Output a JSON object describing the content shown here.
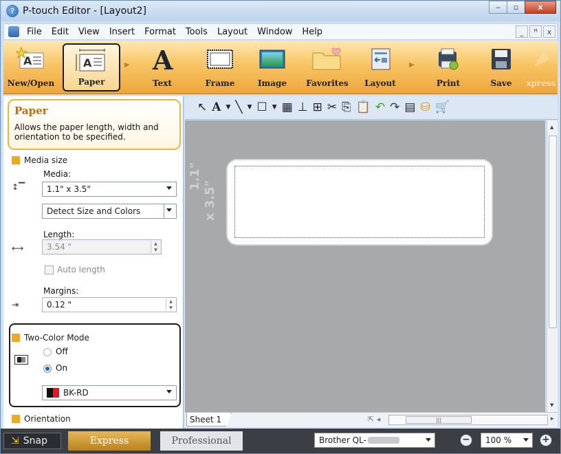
{
  "window": {
    "title": "P-touch Editor - [Layout2]",
    "min_glyph": "‒",
    "max_glyph": "▫",
    "close_glyph": "x"
  },
  "menubar": {
    "items": [
      "File",
      "Edit",
      "View",
      "Insert",
      "Format",
      "Tools",
      "Layout",
      "Window",
      "Help"
    ],
    "min_glyph": "_",
    "restore_glyph": "ꟸ",
    "close_glyph": "x"
  },
  "ribbon": {
    "buttons": [
      {
        "label": "New/Open",
        "icon": "new-open-icon"
      },
      {
        "label": "Paper",
        "icon": "paper-icon"
      },
      {
        "label": "Text",
        "icon": "text-icon"
      },
      {
        "label": "Frame",
        "icon": "frame-icon"
      },
      {
        "label": "Image",
        "icon": "image-icon"
      },
      {
        "label": "Favorites",
        "icon": "favorites-icon"
      },
      {
        "label": "Layout",
        "icon": "layout-icon"
      },
      {
        "label": "Print",
        "icon": "print-icon"
      },
      {
        "label": "Save",
        "icon": "save-icon"
      },
      {
        "label": "xpress",
        "icon": "express-icon"
      }
    ]
  },
  "panel": {
    "title": "Paper",
    "description": "Allows the paper length, width and orientation to be specified.",
    "media_size": {
      "heading": "Media size",
      "media_label": "Media:",
      "media_value": "1.1\" x 3.5\"",
      "detect_value": "Detect Size and Colors",
      "length_label": "Length:",
      "length_value": "3.54 \"",
      "auto_length_label": "Auto length",
      "margins_label": "Margins:",
      "margins_value": "0.12 \""
    },
    "two_color": {
      "heading": "Two-Color Mode",
      "off_label": "Off",
      "on_label": "On",
      "selected": "On",
      "color_value": "BK-RD"
    },
    "orientation": {
      "heading": "Orientation"
    }
  },
  "canvas": {
    "ruler_text_1": "1.1\"",
    "ruler_text_2": "x 3.5\""
  },
  "sheetbar": {
    "tab_label": "Sheet 1"
  },
  "statusbar": {
    "snap_label": "Snap",
    "express_label": "Express",
    "professional_label": "Professional",
    "printer_value": "Brother QL-",
    "zoom_value": "100 %",
    "zoom_out_glyph": "−",
    "zoom_in_glyph": "+"
  }
}
